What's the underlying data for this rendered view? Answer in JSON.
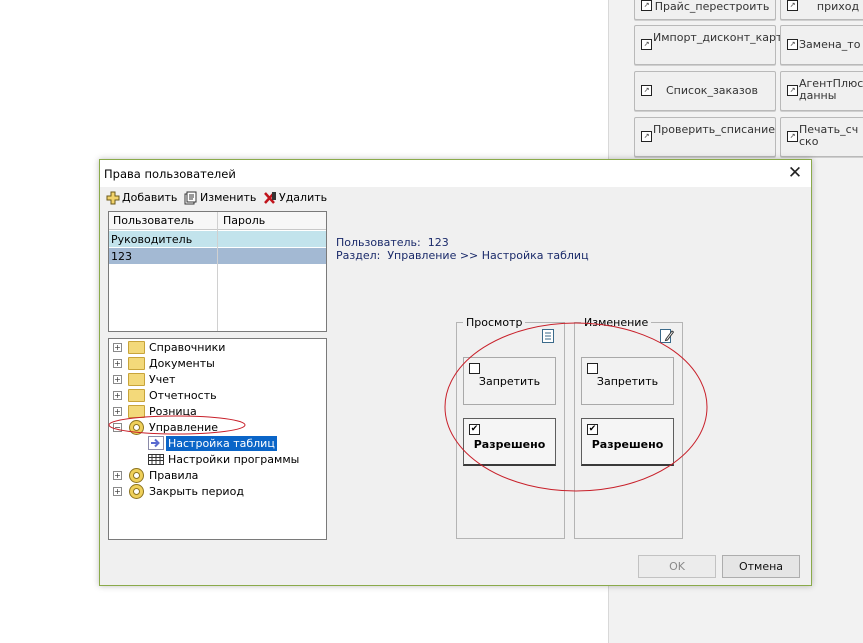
{
  "background": {
    "buttons": [
      {
        "label": "Прайс_перестроить"
      },
      {
        "label": "приход"
      },
      {
        "label": "Импорт_дисконт_карт"
      },
      {
        "label": "Замена_то"
      },
      {
        "label": "Список_заказов"
      },
      {
        "label": "АгентПлюс данны"
      },
      {
        "label": "Проверить_списание"
      },
      {
        "label": "Печать_сч ско"
      }
    ]
  },
  "dialog": {
    "title": "Права пользователей",
    "close_symbol": "✕",
    "toolbar": {
      "add_label": "Добавить",
      "edit_label": "Изменить",
      "delete_label": "Удалить"
    },
    "users_grid": {
      "columns": [
        "Пользователь",
        "Пароль"
      ],
      "rows": [
        {
          "user": "Руководитель",
          "password": ""
        },
        {
          "user": "123",
          "password": ""
        }
      ]
    },
    "tree": [
      {
        "label": "Справочники",
        "expander": "+"
      },
      {
        "label": "Документы",
        "expander": "+"
      },
      {
        "label": "Учет",
        "expander": "+"
      },
      {
        "label": "Отчетность",
        "expander": "+"
      },
      {
        "label": "Розница",
        "expander": "+"
      },
      {
        "label": "Управление",
        "expander": "−"
      },
      {
        "label": "Настройка таблиц",
        "expander": ""
      },
      {
        "label": "Настройки программы",
        "expander": ""
      },
      {
        "label": "Правила",
        "expander": "+"
      },
      {
        "label": "Закрыть период",
        "expander": "+"
      }
    ],
    "info": {
      "user_line": "Пользователь:  123",
      "section_line": "Раздел:  Управление >> Настройка таблиц"
    },
    "view_group": {
      "label": "Просмотр",
      "deny_label": "Запретить",
      "allow_label": "Разрешено",
      "deny_checked": false,
      "allow_checked": true
    },
    "edit_group": {
      "label": "Изменение",
      "deny_label": "Запретить",
      "allow_label": "Разрешено",
      "deny_checked": false,
      "allow_checked": true
    },
    "ok_label": "OK",
    "cancel_label": "Отмена"
  },
  "colors": {
    "selection": "#0a65c8",
    "annotation": "#c8202a",
    "grid_row_1": "#c2e3ec",
    "grid_row_2": "#a3b9d3",
    "dialog_border": "#8aaa4a",
    "info_text": "#1a2a6a"
  },
  "icons": [
    "add-icon",
    "edit-icon",
    "delete-icon",
    "close-icon",
    "folder-icon",
    "gear-folder-icon",
    "arrow-icon",
    "table-icon",
    "view-doc-icon",
    "edit-doc-icon",
    "checkbox-icon",
    "shortcut-icon"
  ]
}
